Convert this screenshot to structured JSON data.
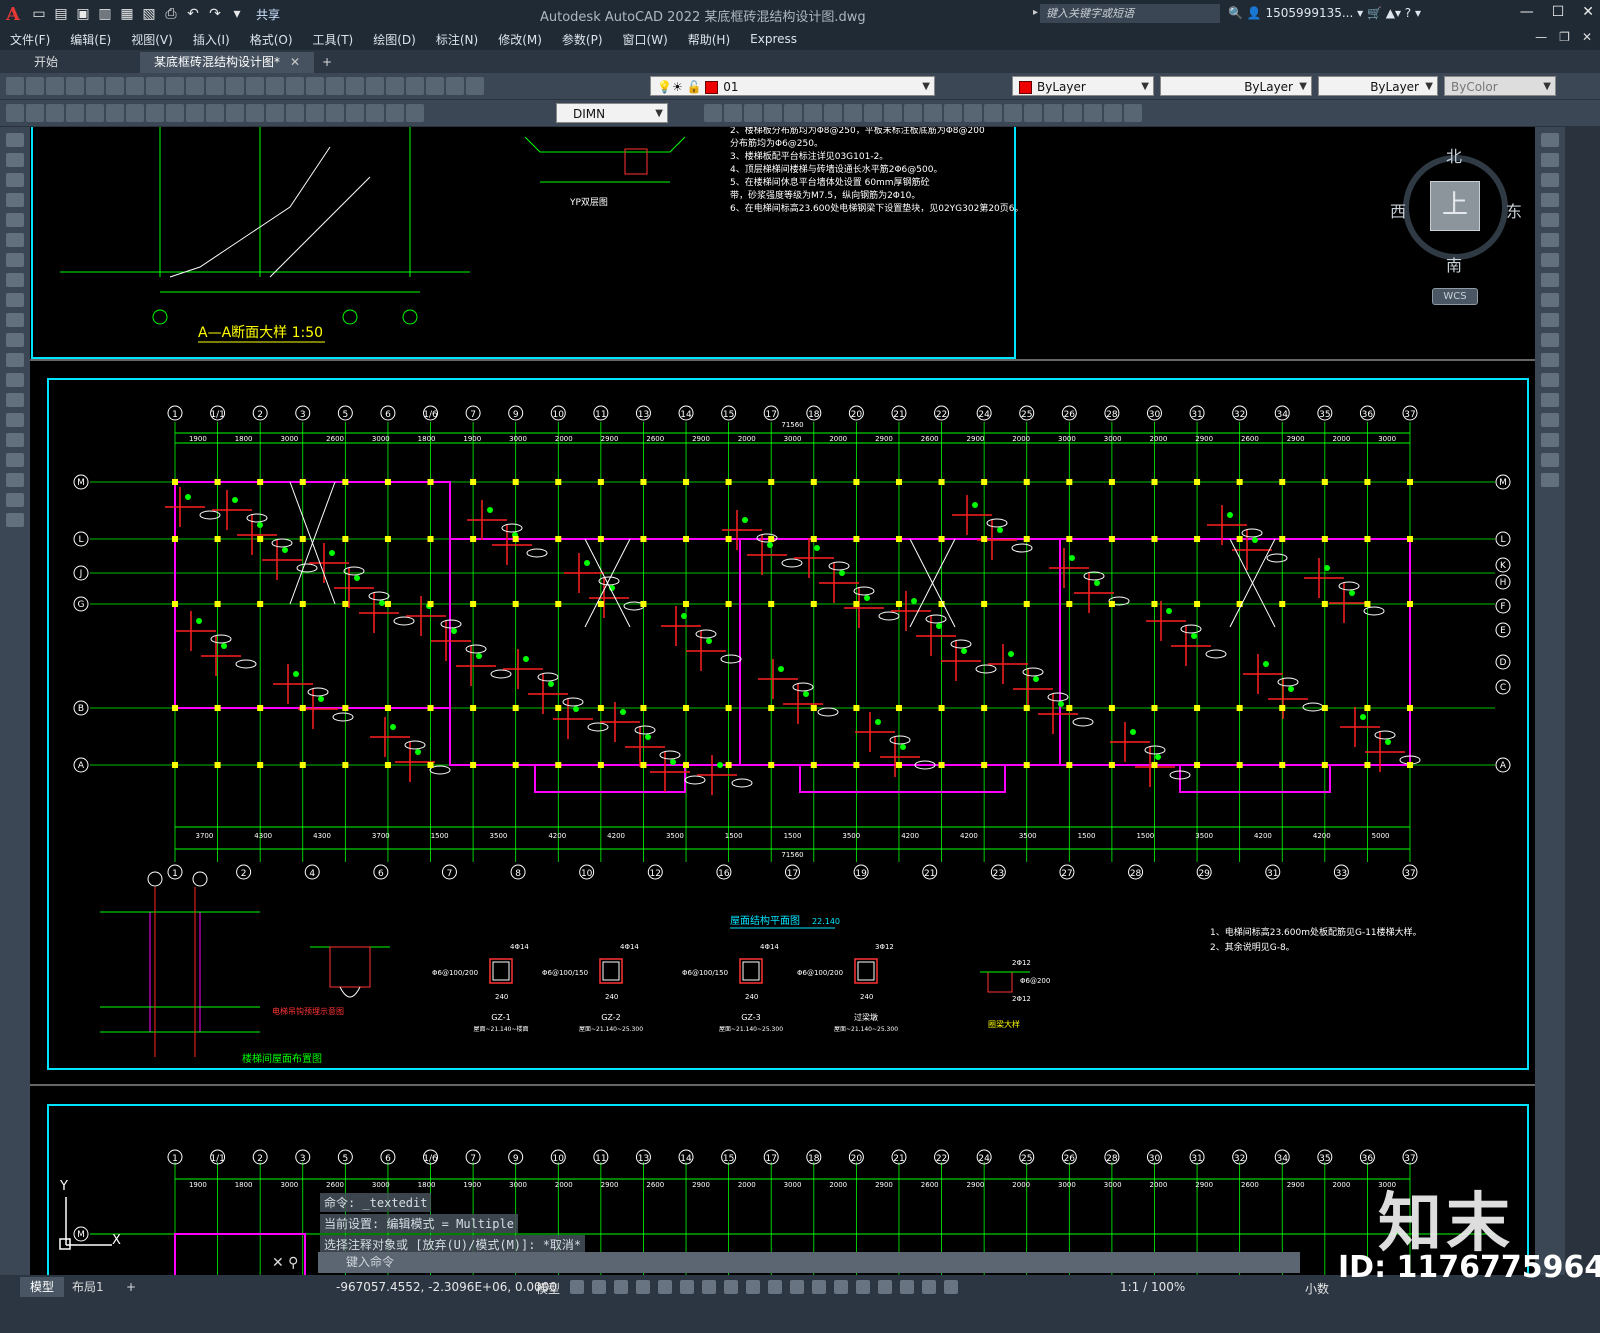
{
  "window": {
    "title": "Autodesk AutoCAD 2022    某底框砖混结构设计图.dwg",
    "share": "共享",
    "search_placeholder": "键入关键字或短语",
    "user": "1505999135...",
    "controls": [
      "—",
      "☐",
      "✕"
    ]
  },
  "menu": [
    "文件(F)",
    "编辑(E)",
    "视图(V)",
    "插入(I)",
    "格式(O)",
    "工具(T)",
    "绘图(D)",
    "标注(N)",
    "修改(M)",
    "参数(P)",
    "窗口(W)",
    "帮助(H)",
    "Express"
  ],
  "tabs": [
    {
      "label": "开始"
    },
    {
      "label": "某底框砖混结构设计图*"
    }
  ],
  "toolbar": {
    "layer": "01",
    "color": "ByLayer",
    "linetype": "ByLayer",
    "lineweight": "ByLayer",
    "plotstyle": "ByColor",
    "dimstyle": "DIMN",
    "colors": {
      "layer_swatch": "#e00000"
    }
  },
  "viewcube": {
    "north": "北",
    "south": "南",
    "east": "东",
    "west": "西",
    "face": "上",
    "wcs": "WCS"
  },
  "drawing": {
    "section_title": "A—A断面大样  1:50",
    "notes_top": [
      "2、楼梯板分布筋均为Φ8@250，平板未标注板底筋为Φ8@200",
      "   分布筋均为Φ6@250。",
      "3、楼梯板配平台标注详见03G101-2。",
      "4、顶层梯梯间楼梯与砖墙设通长水平筋2Φ6@500。",
      "5、在楼梯间休息平台墙体处设置 60mm厚钢筋砼",
      "   带，砂浆强度等级为M7.5，纵向钢筋为2Φ10。",
      "6、在电梯间标高23.600处电梯钢梁下设置垫块，见02YG302第20页6。"
    ],
    "yp_label": "YP双层图",
    "plan_title": "屋面结构平面图",
    "plan_scale": "22.140",
    "notes_right": [
      "1、电梯间标高23.600m处板配筋见G-11楼梯大样。",
      "2、其余说明见G-8。"
    ],
    "stair_title": "楼梯间屋面布置图",
    "elevator_label": "电梯吊钩预埋示意图",
    "total_dim": "71560",
    "grid_top": [
      "1",
      "1/1",
      "2",
      "3",
      "5",
      "6",
      "1/6",
      "7",
      "9",
      "10",
      "11",
      "13",
      "14",
      "15",
      "17",
      "18",
      "20",
      "21",
      "22",
      "24",
      "25",
      "26",
      "28",
      "30",
      "31",
      "32",
      "34",
      "35",
      "36",
      "37"
    ],
    "grid_bottom": [
      "1",
      "2",
      "4",
      "6",
      "7",
      "8",
      "10",
      "12",
      "16",
      "17",
      "19",
      "21",
      "23",
      "27",
      "28",
      "29",
      "31",
      "33",
      "37"
    ],
    "grid_left": [
      "M",
      "L",
      "J",
      "G",
      "B",
      "A"
    ],
    "grid_right": [
      "M",
      "L",
      "K",
      "H",
      "F",
      "E",
      "D",
      "C",
      "A"
    ],
    "dims_top": [
      "1900",
      "1800",
      "3000",
      "2600",
      "3000",
      "1800",
      "1900",
      "3000",
      "2000",
      "2900",
      "2600",
      "2900",
      "2000",
      "3000",
      "2000",
      "2900",
      "2600",
      "2900",
      "2000",
      "3000",
      "3000",
      "2000",
      "2900",
      "2600",
      "2900",
      "2000",
      "3000"
    ],
    "dims_bottom": [
      "3700",
      "4300",
      "4300",
      "3700",
      "1500",
      "3500",
      "4200",
      "4200",
      "3500",
      "1500",
      "1500",
      "3500",
      "4200",
      "4200",
      "3500",
      "1500",
      "1500",
      "3500",
      "4200",
      "4200",
      "5000"
    ],
    "gz": [
      {
        "name": "GZ-1",
        "elev": "屋面~21.140~楼面",
        "bars": "4Φ14",
        "stirrup": "Φ6@100/200",
        "w": "240"
      },
      {
        "name": "GZ-2",
        "elev": "屋面~21.140~25.300",
        "bars": "4Φ14",
        "stirrup": "Φ6@100/150",
        "w": "240"
      },
      {
        "name": "GZ-3",
        "elev": "屋面~21.140~25.300",
        "bars": "4Φ14",
        "stirrup": "Φ6@100/150",
        "w": "240"
      },
      {
        "name": "过梁墩",
        "elev": "屋面~21.140~25.300",
        "bars": "3Φ12",
        "stirrup": "Φ6@100/200",
        "w": "240"
      }
    ],
    "circle_detail": "圈梁大样",
    "circle_bars": [
      "2Φ12",
      "Φ6@200",
      "2Φ12"
    ]
  },
  "command": {
    "lines": [
      "命令: _textedit",
      "当前设置: 编辑模式 = Multiple",
      "选择注释对象或 [放弃(U)/模式(M)]: *取消*"
    ],
    "input_placeholder": "键入命令"
  },
  "status": {
    "layouts": [
      "模型",
      "布局1",
      "+"
    ],
    "coords": "-967057.4552, -2.3096E+06, 0.0000",
    "model": "模型",
    "scale": "1:1 / 100%",
    "units": "小数"
  },
  "watermark": {
    "brand": "知末",
    "id": "ID: 1176775964"
  }
}
